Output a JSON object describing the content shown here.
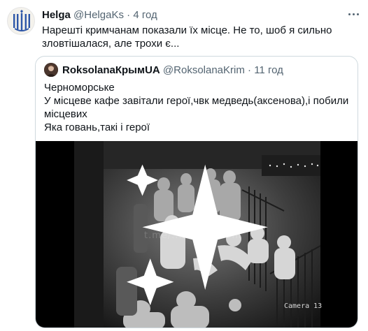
{
  "tweet": {
    "author_name": "Helga",
    "author_handle": "@HelgaKs",
    "separator": "·",
    "time": "4 год",
    "text": "Нарешті кримчанам показали їх місце. Не то, шоб я сильно зловтішалася, але трохи є...",
    "avatar_icon": "trident-avatar-icon",
    "more_icon": "more-options-icon"
  },
  "quote": {
    "author_name": "RoksolanaКрымUA",
    "author_handle": "@RoksolanaKrim",
    "separator": "·",
    "time": "11 год",
    "lines": [
      "Черноморське",
      "У місцеве кафе завітали герої,чвк медведь(аксенова),і побили",
      "місцевих",
      "Яка говань,такі і герої"
    ],
    "media": {
      "watermark": "t.me/....crimeroom",
      "camera_label": "Camera 13",
      "sparkle_icon": "sparkle-icon"
    }
  },
  "colors": {
    "text": "#0f1419",
    "secondary": "#536471",
    "border": "#cfd9de",
    "avatar_blue": "#2e57a8"
  }
}
